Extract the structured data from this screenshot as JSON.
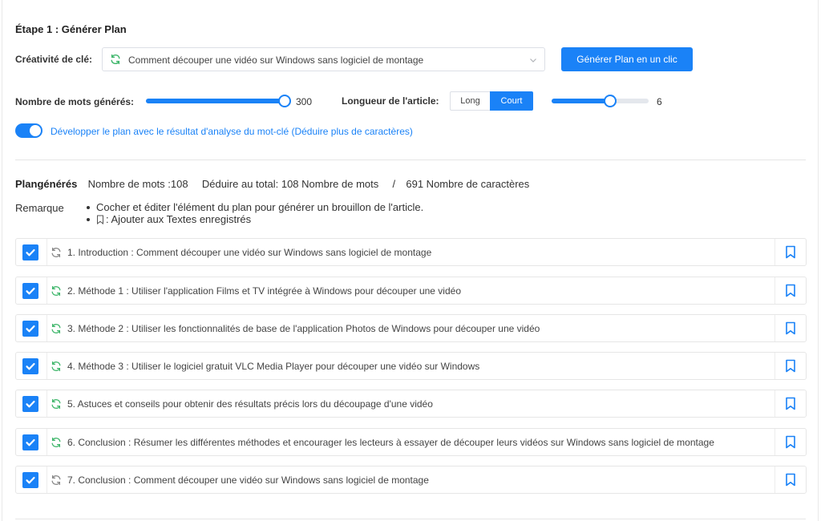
{
  "step": {
    "title": "Étape 1 : Générer Plan"
  },
  "keyword": {
    "label": "Créativité de clé:",
    "value": "Comment découper une vidéo sur Windows sans logiciel de montage",
    "generate_button": "Générer Plan en un clic"
  },
  "words_slider": {
    "label": "Nombre de mots générés:",
    "value": "300",
    "fraction": 1.0
  },
  "length": {
    "label": "Longueur de l'article:",
    "options": [
      "Long",
      "Court"
    ],
    "selected": "Court",
    "slider_value": "6",
    "fraction": 0.6
  },
  "toggle": {
    "on": true,
    "label": "Développer le plan avec le résultat d'analyse du mot-clé (Déduire plus de caractères)"
  },
  "summary": {
    "title": "Plangénérés",
    "words": "Nombre de mots :108",
    "deduct": "Déduire au total: 108 Nombre de mots",
    "separator": "/",
    "chars": "691 Nombre de caractères"
  },
  "remark": {
    "label": "Remarque",
    "line1": "Cocher et éditer l'élément du plan pour générer un brouillon de l'article.",
    "line2": ": Ajouter aux Textes enregistrés"
  },
  "colors": {
    "accent": "#1a82f7",
    "refresh_active": "#3fb66b",
    "refresh_inactive": "#888888"
  },
  "outline": [
    {
      "text": "1. Introduction : Comment découper une vidéo sur Windows sans logiciel de montage",
      "checked": true,
      "icon": "refresh-gray-icon"
    },
    {
      "text": "2. Méthode 1 : Utiliser l'application Films et TV intégrée à Windows pour découper une vidéo",
      "checked": true,
      "icon": "refresh-green-icon"
    },
    {
      "text": "3. Méthode 2 : Utiliser les fonctionnalités de base de l'application Photos de Windows pour découper une vidéo",
      "checked": true,
      "icon": "refresh-green-icon"
    },
    {
      "text": "4. Méthode 3 : Utiliser le logiciel gratuit VLC Media Player pour découper une vidéo sur Windows",
      "checked": true,
      "icon": "refresh-green-icon"
    },
    {
      "text": "5. Astuces et conseils pour obtenir des résultats précis lors du découpage d'une vidéo",
      "checked": true,
      "icon": "refresh-green-icon"
    },
    {
      "text": "6. Conclusion : Résumer les différentes méthodes et encourager les lecteurs à essayer de découper leurs vidéos sur Windows sans logiciel de montage",
      "checked": true,
      "icon": "refresh-green-icon"
    },
    {
      "text": "7. Conclusion : Comment découper une vidéo sur Windows sans logiciel de montage",
      "checked": true,
      "icon": "refresh-gray-icon"
    }
  ]
}
